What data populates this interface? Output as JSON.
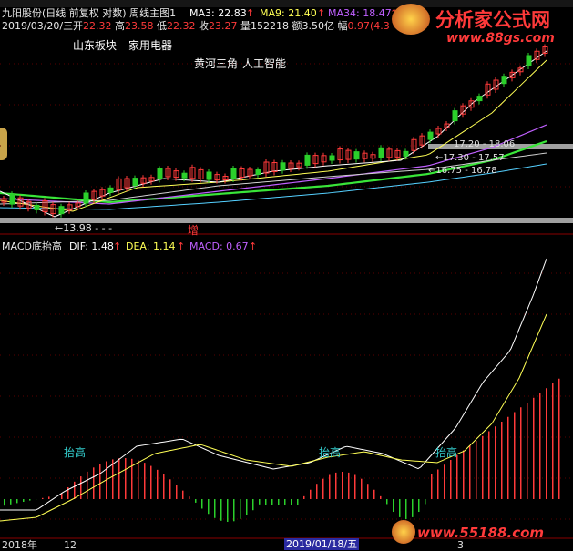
{
  "header": {
    "title": "九阳股份(日线 前复权 对数) 周线主图1",
    "ma3": "MA3: 22.83",
    "ma9": "MA9: 21.40",
    "ma34": "MA34: 18.47",
    "arrow": "↑"
  },
  "quote": {
    "date": "2019/03/20/三",
    "open_label": "开",
    "open": "22.32",
    "high_label": "高",
    "high": "23.58",
    "low_label": "低",
    "low": "22.32",
    "close_label": "收",
    "close": "23.27",
    "vol_label": "量",
    "vol": "152218",
    "amount_label": "额",
    "amount": "3.50亿",
    "change_label": "幅",
    "change": "0.97(4.3"
  },
  "tags": {
    "sector": "山东板块",
    "industry": "家用电器",
    "concept1": "黄河三角",
    "concept2": "人工智能"
  },
  "price_labels": {
    "low_mark": "13.98",
    "zeng": "增",
    "right1a": "17.20",
    "right1b": "18.06",
    "right2a": "17.30",
    "right2b": "17.57",
    "right3a": "16.75",
    "right3b": "16.78"
  },
  "macd": {
    "title": "MACD底抬高",
    "dif": "DIF: 1.48",
    "dea": "DEA: 1.14",
    "macd": "MACD: 0.67",
    "arrow": "↑",
    "tai_gao": "抬高"
  },
  "xaxis": {
    "year": "2018年",
    "m12": "12",
    "cursor_date": "2019/01/18/五",
    "m3": "3"
  },
  "watermark": {
    "site_cn": "分析家公式网",
    "site_url1": "www.88gs.com",
    "site_url2": "www.55188.com"
  },
  "colors": {
    "up": "#ff3a3a",
    "down": "#2bd02b",
    "ma_white": "#ffffff",
    "ma_yellow": "#ffff55",
    "ma_purple": "#c060ff",
    "ma_green": "#39e639",
    "ma_cyan": "#55d0ff",
    "text_yellow": "#f0f000",
    "text_cyan": "#33cccc"
  }
}
